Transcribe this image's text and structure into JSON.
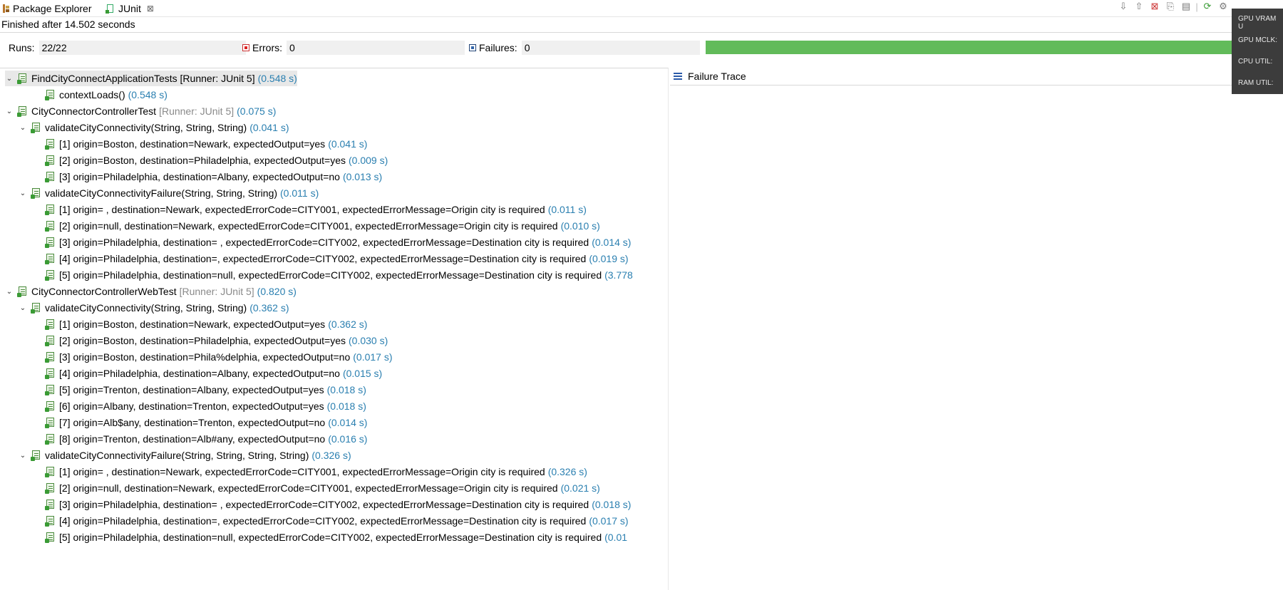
{
  "tabs": {
    "package_explorer": "Package Explorer",
    "junit": "JUnit",
    "close": "⊠"
  },
  "status": "Finished after 14.502 seconds",
  "counters": {
    "runs_label": "Runs:",
    "runs_value": "22/22",
    "errors_label": "Errors:",
    "errors_value": "0",
    "failures_label": "Failures:",
    "failures_value": "0"
  },
  "progress": {
    "fraction": 1.0,
    "color": "#62bb5a"
  },
  "failure_trace": "Failure Trace",
  "overlay": [
    "GPU VRAM U",
    "GPU MCLK:",
    "CPU UTIL:",
    "RAM UTIL:"
  ],
  "tree": [
    {
      "level": 0,
      "label": "FindCityConnectApplicationTests [Runner: JUnit 5]",
      "runner": "",
      "time": "(0.548 s)",
      "expand": "v",
      "selected": true
    },
    {
      "level": 2,
      "label": "contextLoads()",
      "runner": "",
      "time": "(0.548 s)",
      "expand": ""
    },
    {
      "level": 0,
      "label": "CityConnectorControllerTest",
      "runner": "[Runner: JUnit 5]",
      "time": "(0.075 s)",
      "expand": "v"
    },
    {
      "level": 1,
      "label": "validateCityConnectivity(String, String, String)",
      "runner": "",
      "time": "(0.041 s)",
      "expand": "v"
    },
    {
      "level": 2,
      "label": "[1] origin=Boston, destination=Newark, expectedOutput=yes",
      "runner": "",
      "time": "(0.041 s)",
      "expand": ""
    },
    {
      "level": 2,
      "label": "[2] origin=Boston, destination=Philadelphia, expectedOutput=yes",
      "runner": "",
      "time": "(0.009 s)",
      "expand": ""
    },
    {
      "level": 2,
      "label": "[3] origin=Philadelphia, destination=Albany, expectedOutput=no",
      "runner": "",
      "time": "(0.013 s)",
      "expand": ""
    },
    {
      "level": 1,
      "label": "validateCityConnectivityFailure(String, String, String)",
      "runner": "",
      "time": "(0.011 s)",
      "expand": "v"
    },
    {
      "level": 2,
      "label": "[1] origin= , destination=Newark, expectedErrorCode=CITY001, expectedErrorMessage=Origin city is required",
      "runner": "",
      "time": "(0.011 s)",
      "expand": ""
    },
    {
      "level": 2,
      "label": "[2] origin=null, destination=Newark, expectedErrorCode=CITY001, expectedErrorMessage=Origin city is required",
      "runner": "",
      "time": "(0.010 s)",
      "expand": ""
    },
    {
      "level": 2,
      "label": "[3] origin=Philadelphia, destination= , expectedErrorCode=CITY002, expectedErrorMessage=Destination city is required",
      "runner": "",
      "time": "(0.014 s)",
      "expand": ""
    },
    {
      "level": 2,
      "label": "[4] origin=Philadelphia, destination=, expectedErrorCode=CITY002, expectedErrorMessage=Destination city is required",
      "runner": "",
      "time": "(0.019 s)",
      "expand": ""
    },
    {
      "level": 2,
      "label": "[5] origin=Philadelphia, destination=null, expectedErrorCode=CITY002, expectedErrorMessage=Destination city is required",
      "runner": "",
      "time": "(3.778",
      "expand": ""
    },
    {
      "level": 0,
      "label": "CityConnectorControllerWebTest",
      "runner": "[Runner: JUnit 5]",
      "time": "(0.820 s)",
      "expand": "v"
    },
    {
      "level": 1,
      "label": "validateCityConnectivity(String, String, String)",
      "runner": "",
      "time": "(0.362 s)",
      "expand": "v"
    },
    {
      "level": 2,
      "label": "[1] origin=Boston, destination=Newark, expectedOutput=yes",
      "runner": "",
      "time": "(0.362 s)",
      "expand": ""
    },
    {
      "level": 2,
      "label": "[2] origin=Boston, destination=Philadelphia, expectedOutput=yes",
      "runner": "",
      "time": "(0.030 s)",
      "expand": ""
    },
    {
      "level": 2,
      "label": "[3] origin=Boston, destination=Phila%delphia, expectedOutput=no",
      "runner": "",
      "time": "(0.017 s)",
      "expand": ""
    },
    {
      "level": 2,
      "label": "[4] origin=Philadelphia, destination=Albany, expectedOutput=no",
      "runner": "",
      "time": "(0.015 s)",
      "expand": ""
    },
    {
      "level": 2,
      "label": "[5] origin=Trenton, destination=Albany, expectedOutput=yes",
      "runner": "",
      "time": "(0.018 s)",
      "expand": ""
    },
    {
      "level": 2,
      "label": "[6] origin=Albany, destination=Trenton, expectedOutput=yes",
      "runner": "",
      "time": "(0.018 s)",
      "expand": ""
    },
    {
      "level": 2,
      "label": "[7] origin=Alb$any, destination=Trenton, expectedOutput=no",
      "runner": "",
      "time": "(0.014 s)",
      "expand": ""
    },
    {
      "level": 2,
      "label": "[8] origin=Trenton, destination=Alb#any, expectedOutput=no",
      "runner": "",
      "time": "(0.016 s)",
      "expand": ""
    },
    {
      "level": 1,
      "label": "validateCityConnectivityFailure(String, String, String, String)",
      "runner": "",
      "time": "(0.326 s)",
      "expand": "v"
    },
    {
      "level": 2,
      "label": "[1] origin= , destination=Newark, expectedErrorCode=CITY001, expectedErrorMessage=Origin city is required",
      "runner": "",
      "time": "(0.326 s)",
      "expand": ""
    },
    {
      "level": 2,
      "label": "[2] origin=null, destination=Newark, expectedErrorCode=CITY001, expectedErrorMessage=Origin city is required",
      "runner": "",
      "time": "(0.021 s)",
      "expand": ""
    },
    {
      "level": 2,
      "label": "[3] origin=Philadelphia, destination= , expectedErrorCode=CITY002, expectedErrorMessage=Destination city is required",
      "runner": "",
      "time": "(0.018 s)",
      "expand": ""
    },
    {
      "level": 2,
      "label": "[4] origin=Philadelphia, destination=, expectedErrorCode=CITY002, expectedErrorMessage=Destination city is required",
      "runner": "",
      "time": "(0.017 s)",
      "expand": ""
    },
    {
      "level": 2,
      "label": "[5] origin=Philadelphia, destination=null, expectedErrorCode=CITY002, expectedErrorMessage=Destination city is required",
      "runner": "",
      "time": "(0.01",
      "expand": ""
    }
  ],
  "icons": {
    "package": "package-explorer-icon",
    "junit": "junit-icon",
    "test": "test-ok-icon"
  }
}
